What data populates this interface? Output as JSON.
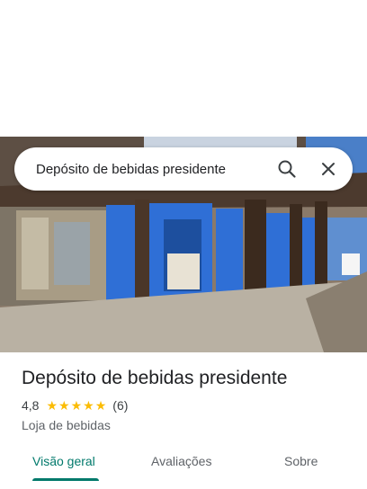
{
  "search": {
    "query": "Depósito de bebidas presidente",
    "search_icon": "search-icon",
    "close_icon": "close-icon"
  },
  "place": {
    "name": "Depósito de bebidas presidente",
    "rating": "4,8",
    "stars": 5,
    "review_count": "(6)",
    "category": "Loja de bebidas"
  },
  "tabs": [
    {
      "label": "Visão geral",
      "active": true
    },
    {
      "label": "Avaliações",
      "active": false
    },
    {
      "label": "Sobre",
      "active": false
    }
  ],
  "colors": {
    "accent": "#00796b",
    "star": "#fbbc04",
    "storefront_blue": "#2f6fd6"
  }
}
